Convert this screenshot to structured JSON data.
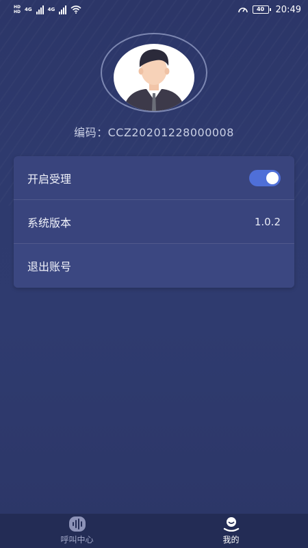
{
  "status_bar": {
    "left_tags": [
      "HD",
      "4G",
      "4G"
    ],
    "battery": "40",
    "time": "20:49"
  },
  "profile": {
    "code_label": "编码：",
    "code_value": "CCZ20201228000008"
  },
  "settings": {
    "accept_label": "开启受理",
    "accept_enabled": true,
    "version_label": "系统版本",
    "version_value": "1.0.2",
    "logout_label": "退出账号"
  },
  "tabbar": {
    "tabs": [
      {
        "label": "呼叫中心",
        "icon": "voice-wave-icon",
        "active": false
      },
      {
        "label": "我的",
        "icon": "user-profile-icon",
        "active": true
      }
    ]
  },
  "colors": {
    "background": "#2e3a6e",
    "card": "#39447d",
    "toggle_on": "#4f6fd8",
    "tabbar": "#232c55"
  }
}
